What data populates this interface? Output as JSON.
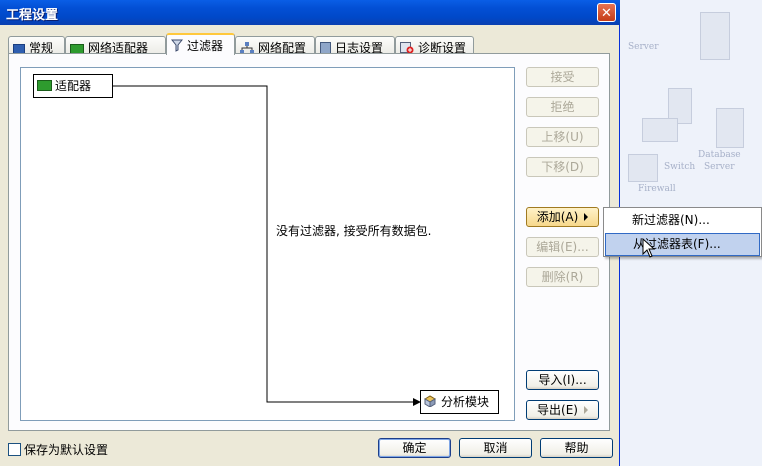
{
  "window": {
    "title": "工程设置",
    "close_label": "✕"
  },
  "tabs": [
    {
      "label": "常规"
    },
    {
      "label": "网络适配器"
    },
    {
      "label": "过滤器"
    },
    {
      "label": "网络配置"
    },
    {
      "label": "日志设置"
    },
    {
      "label": "诊断设置"
    }
  ],
  "canvas": {
    "adapter_node": "适配器",
    "message": "没有过滤器, 接受所有数据包.",
    "analysis_node": "分析模块"
  },
  "buttons": {
    "accept": "接受",
    "reject": "拒绝",
    "move_up": "上移(U)",
    "move_down": "下移(D)",
    "add": "添加(A)",
    "edit": "编辑(E)...",
    "delete": "删除(R)",
    "import": "导入(I)...",
    "export": "导出(E)",
    "ok": "确定",
    "cancel": "取消",
    "help": "帮助"
  },
  "add_menu": {
    "items": [
      {
        "label": "新过滤器(N)..."
      },
      {
        "label": "从过滤器表(F)..."
      }
    ]
  },
  "footer": {
    "save_default": "保存为默认设置",
    "save_default_checked": false
  },
  "background": {
    "labels": [
      "Server",
      "Firewall",
      "Switch",
      "Database",
      "Server"
    ]
  },
  "colors": {
    "title_blue": "#0350d6",
    "tab_active_accent": "#ffc83c",
    "menu_highlight": "#c1d2ee"
  }
}
